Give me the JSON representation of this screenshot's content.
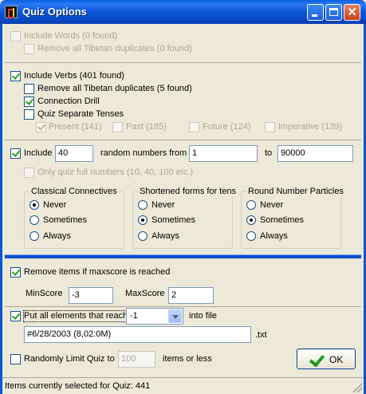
{
  "window": {
    "title": "Quiz Options"
  },
  "words": {
    "include_label": "Include Words (0 found)",
    "remove_dupes_label": "Remove all Tibetan duplicates (0 found)"
  },
  "verbs": {
    "include_label": "Include Verbs (401 found)",
    "remove_dupes_label": "Remove all Tibetan duplicates (5 found)",
    "connection_drill_label": "Connection Drill",
    "separate_tenses_label": "Quiz Separate Tenses",
    "tenses": [
      {
        "label": "Present (141)",
        "checked": true
      },
      {
        "label": "Past (185)",
        "checked": false
      },
      {
        "label": "Future (124)",
        "checked": false
      },
      {
        "label": "Imperative (139)",
        "checked": false
      }
    ]
  },
  "numbers": {
    "include_label": "Include",
    "count_value": "40",
    "random_from_label": "random numbers from",
    "from_value": "1",
    "to_label": "to",
    "to_value": "90000",
    "full_numbers_label": "Only quiz full numbers (10, 40, 100 etc.)",
    "groups": [
      {
        "title": "Classical Connectives",
        "options": [
          "Never",
          "Sometimes",
          "Always"
        ],
        "selected": "Never"
      },
      {
        "title": "Shortened forms for tens",
        "options": [
          "Never",
          "Sometimes",
          "Always"
        ],
        "selected": "Sometimes"
      },
      {
        "title": "Round Number Particles",
        "options": [
          "Never",
          "Sometimes",
          "Always"
        ],
        "selected": "Sometimes"
      }
    ]
  },
  "score": {
    "remove_maxscore_label": "Remove items if maxscore is reached",
    "min_label": "MinScore",
    "min_value": "-3",
    "max_label": "MaxScore",
    "max_value": "2"
  },
  "file": {
    "put_all_label": "Put all elements that reach",
    "reach_value": "-1",
    "into_file_label": "into file",
    "filename_value": "#6/28/2003 (8,02:0M)",
    "extension_label": ".txt"
  },
  "limit": {
    "random_limit_label": "Randomly Limit Quiz to",
    "limit_value": "100",
    "items_label": "items or less"
  },
  "ok_button": {
    "label": "OK"
  },
  "status": {
    "text": "Items currently selected for Quiz: 441"
  }
}
